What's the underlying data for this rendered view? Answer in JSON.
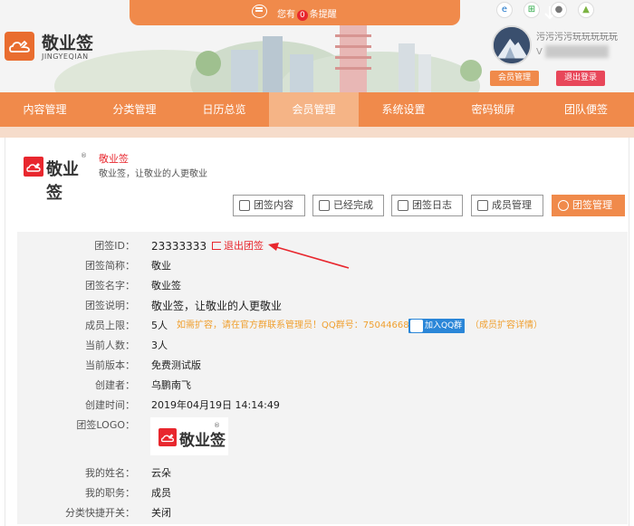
{
  "header": {
    "notice_prefix": "您有",
    "notice_count": "0",
    "notice_suffix": "条提醒",
    "brand_name": "敬业签",
    "brand_sub": "JINGYEQIAN",
    "platforms": [
      "ie-icon",
      "windows-icon",
      "apple-icon",
      "android-icon"
    ],
    "user_name": "污污污污玩玩玩玩玩",
    "user_prefix": "V",
    "member_btn": "会员管理",
    "logout_btn": "退出登录"
  },
  "nav": {
    "items": [
      "内容管理",
      "分类管理",
      "日历总览",
      "会员管理",
      "系统设置",
      "密码锁屏",
      "团队便签"
    ],
    "active_index": 3
  },
  "team": {
    "logo_text": "敬业签",
    "reg_mark": "®",
    "name": "敬业签",
    "desc": "敬业签，让敬业的人更敬业"
  },
  "tabs": [
    "团签内容",
    "已经完成",
    "团签日志",
    "成员管理",
    "团签管理"
  ],
  "info": {
    "id_label": "团签ID：",
    "id_value": "23333333",
    "exit_label": "退出团签",
    "short_label": "团签简称：",
    "short_value": "敬业",
    "name_label": "团签名字：",
    "name_value": "敬业签",
    "desc_label": "团签说明：",
    "desc_value": "敬业签，让敬业的人更敬业",
    "limit_label": "成员上限：",
    "limit_value": "5人",
    "expand_text": "如需扩容，请在官方群联系管理员！QQ群号：750446687",
    "qq_btn": "加入QQ群",
    "expand_detail": "（成员扩容详情）",
    "count_label": "当前人数：",
    "count_value": "3人",
    "version_label": "当前版本：",
    "version_value": "免费测试版",
    "creator_label": "创建者：",
    "creator_value": "乌鹏南飞",
    "created_label": "创建时间：",
    "created_value": "2019年04月19日  14:14:49",
    "logo_label": "团签LOGO：",
    "myname_label": "我的姓名：",
    "myname_value": "云朵",
    "myrole_label": "我的职务：",
    "myrole_value": "成员",
    "shortcut_label": "分类快捷开关：",
    "shortcut_value": "关闭"
  },
  "colors": {
    "accent": "#f08a4b",
    "nav_active": "#f5b486",
    "danger": "#e8272e",
    "qq_blue": "#2a86d8",
    "hint": "#f0a030"
  }
}
